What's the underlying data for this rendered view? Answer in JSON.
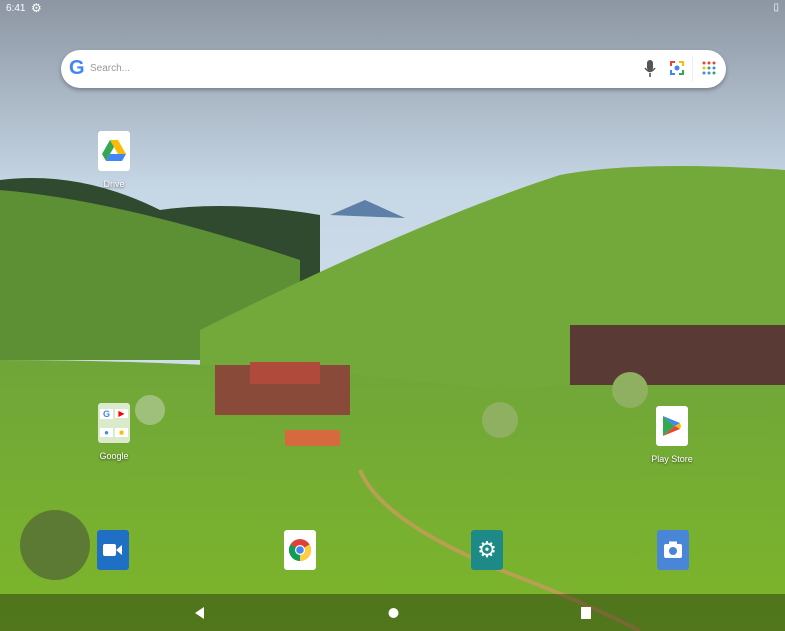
{
  "status_bar": {
    "time": "6:41",
    "settings_icon": "gear-icon",
    "battery_icon": "battery-icon"
  },
  "search": {
    "placeholder": "Search...",
    "icons": [
      "google-g-icon",
      "mic-icon",
      "lens-icon",
      "apps-grid-icon"
    ]
  },
  "apps": [
    {
      "label": "Drive",
      "icon": "drive-icon"
    },
    {
      "label": "Google",
      "icon": "google-folder-icon"
    },
    {
      "label": "Play Store",
      "icon": "play-store-icon"
    }
  ],
  "dock": [
    {
      "icon": "video-camera-icon",
      "color": "#1f6fc5"
    },
    {
      "icon": "chrome-icon",
      "color": "#ffffff"
    },
    {
      "icon": "settings-icon",
      "color": "#1e8a87"
    },
    {
      "icon": "camera-icon",
      "color": "#4a86d8"
    }
  ],
  "nav": {
    "back": "back-icon",
    "home": "home-icon",
    "recents": "recents-icon"
  }
}
